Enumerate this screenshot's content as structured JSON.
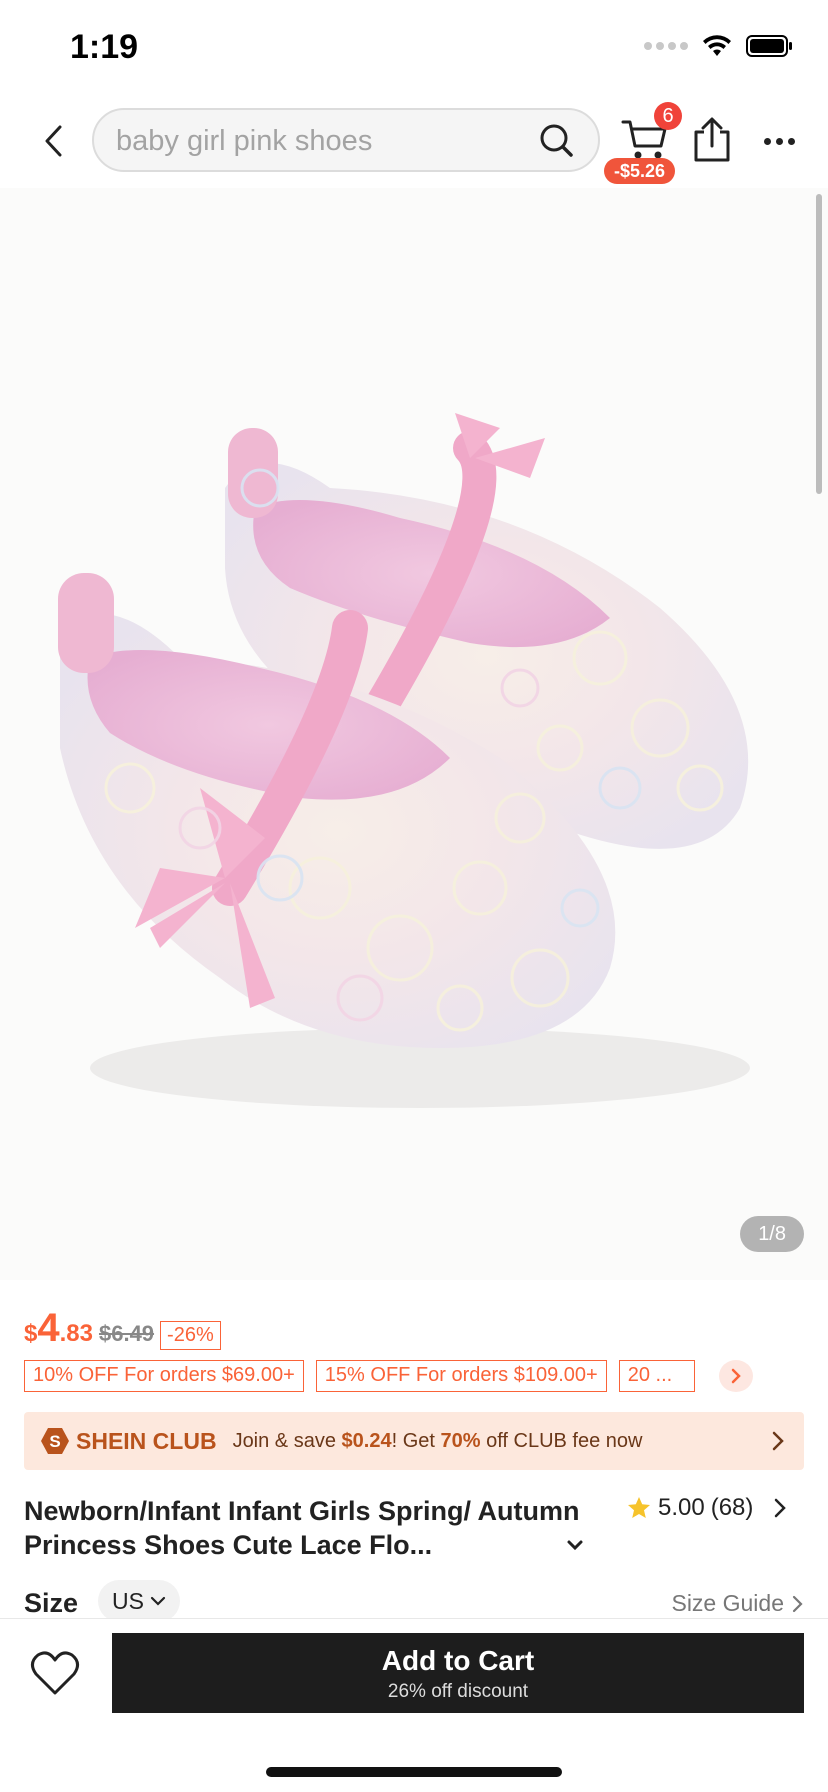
{
  "status_bar": {
    "time": "1:19"
  },
  "header": {
    "search_text": "baby girl pink shoes",
    "cart_count": "6",
    "cart_discount": "-$5.26"
  },
  "image": {
    "counter": "1/8"
  },
  "price": {
    "symbol": "$",
    "integer": "4",
    "decimal": ".83",
    "original": "$6.49",
    "discount": "-26%"
  },
  "coupons": [
    "10% OFF For orders $69.00+",
    "15% OFF For orders $109.00+",
    "20 ..."
  ],
  "club": {
    "name": "SHEIN CLUB",
    "text_1": "Join & save ",
    "save_amount": "$0.24",
    "text_2": "! Get ",
    "percent": "70%",
    "text_3": " off CLUB fee now"
  },
  "product": {
    "title": "Newborn/Infant Infant Girls Spring/ Autumn Princess Shoes Cute Lace Flo...",
    "rating": "5.00",
    "reviews": "(68)"
  },
  "size": {
    "label": "Size",
    "unit": "US",
    "guide": "Size Guide"
  },
  "cta": {
    "label": "Add to Cart",
    "sub": "26% off discount"
  },
  "colors": {
    "price": "#fa6338",
    "cta": "#1d1d1d",
    "club_bg": "#fde8dd",
    "badge": "#f0433a"
  }
}
